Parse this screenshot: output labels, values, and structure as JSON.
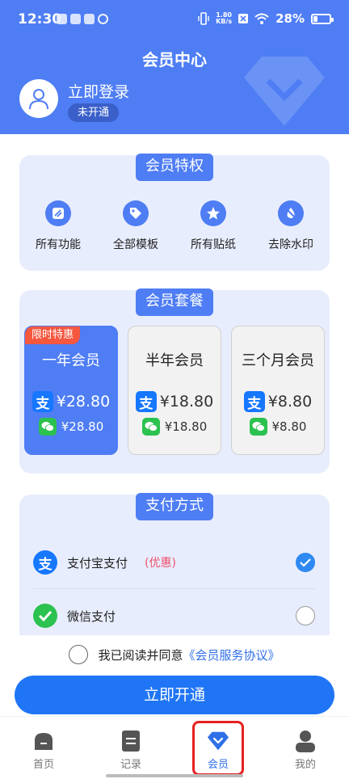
{
  "status_bar": {
    "time": "12:30",
    "net_speed_value": "1.80",
    "net_speed_unit": "KB/s",
    "battery": "28%",
    "battery_level": 0.28
  },
  "header": {
    "title": "会员中心",
    "login_text": "立即登录",
    "member_status": "未开通"
  },
  "privileges": {
    "title": "会员特权",
    "items": [
      {
        "label": "所有功能",
        "icon": "function-icon"
      },
      {
        "label": "全部模板",
        "icon": "tag-icon"
      },
      {
        "label": "所有贴纸",
        "icon": "star-icon"
      },
      {
        "label": "去除水印",
        "icon": "no-watermark-icon"
      }
    ]
  },
  "plans": {
    "title": "会员套餐",
    "promo_tag": "限时特惠",
    "items": [
      {
        "name": "一年会员",
        "alipay_price": "¥28.80",
        "wechat_price": "¥28.80",
        "selected": true
      },
      {
        "name": "半年会员",
        "alipay_price": "¥18.80",
        "wechat_price": "¥18.80",
        "selected": false
      },
      {
        "name": "三个月会员",
        "alipay_price": "¥8.80",
        "wechat_price": "¥8.80",
        "selected": false
      }
    ]
  },
  "payment": {
    "title": "支付方式",
    "methods": [
      {
        "label": "支付宝支付",
        "hint": "(优惠)",
        "checked": true
      },
      {
        "label": "微信支付",
        "hint": "",
        "checked": false
      }
    ]
  },
  "agreement": {
    "text": "我已阅读并同意",
    "link": "《会员服务协议》"
  },
  "open_button": "立即开通",
  "tabs": [
    {
      "label": "首页",
      "active": false
    },
    {
      "label": "记录",
      "active": false
    },
    {
      "label": "会员",
      "active": true
    },
    {
      "label": "我的",
      "active": false
    }
  ],
  "colors": {
    "primary": "#4e7df4",
    "button": "#1f75f5",
    "alipay": "#1677ff",
    "wechat": "#2bc24f",
    "promo": "#f5573f",
    "highlight": "#e62020"
  }
}
